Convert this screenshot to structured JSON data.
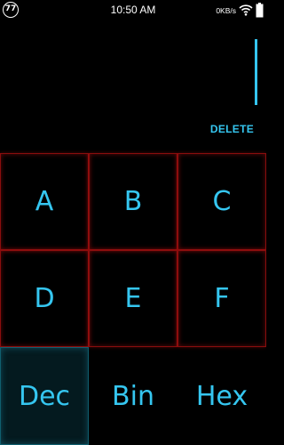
{
  "status_bar": {
    "badge_text": "77",
    "time": "10:50 AM",
    "net_speed": "0KB/s"
  },
  "display": {
    "delete_label": "DELETE"
  },
  "keypad": {
    "keys": [
      "A",
      "B",
      "C",
      "D",
      "E",
      "F"
    ]
  },
  "modes": {
    "items": [
      "Dec",
      "Bin",
      "Hex"
    ],
    "active": "Dec"
  },
  "colors": {
    "accent": "#35c6f0",
    "grid_border": "#8a0d0d",
    "background": "#000000"
  }
}
